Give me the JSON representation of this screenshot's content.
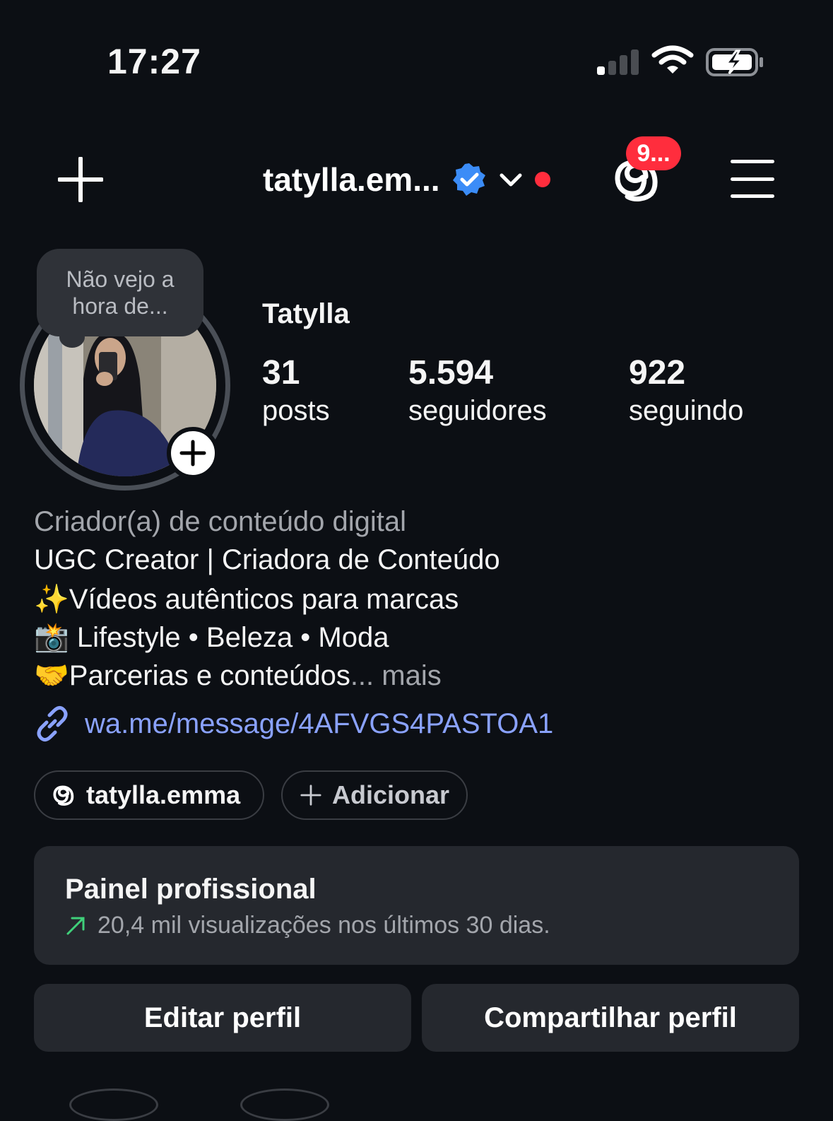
{
  "status_bar": {
    "time": "17:27"
  },
  "header": {
    "username": "tatylla.em...",
    "notification_count": "9..."
  },
  "note": {
    "text": "Não vejo a hora de..."
  },
  "profile": {
    "display_name": "Tatylla",
    "stats": [
      {
        "value": "31",
        "label": "posts"
      },
      {
        "value": "5.594",
        "label": "seguidores"
      },
      {
        "value": "922",
        "label": "seguindo"
      }
    ]
  },
  "bio": {
    "category": "Criador(a) de conteúdo digital",
    "lines": [
      "UGC Creator | Criadora de Conteúdo",
      "✨Vídeos autênticos para marcas",
      "📸 Lifestyle • Beleza • Moda",
      "🤝Parcerias e conteúdos"
    ],
    "ellipsis": "...",
    "more_label": "mais",
    "link": "wa.me/message/4AFVGS4PASTOA1"
  },
  "chips": {
    "threads_handle": "tatylla.emma",
    "add_label": "Adicionar"
  },
  "professional_panel": {
    "title": "Painel profissional",
    "subtitle": "20,4 mil visualizações nos últimos 30 dias."
  },
  "actions": {
    "edit_profile": "Editar perfil",
    "share_profile": "Compartilhar perfil"
  },
  "colors": {
    "background": "#0c0f14",
    "accent_link": "#8aa2ff",
    "verified_blue": "#3b8cf7",
    "badge_red": "#ff2d3d",
    "trend_green": "#3fd07a"
  },
  "icons": [
    "plus-icon",
    "verified-badge-icon",
    "chevron-down-icon",
    "threads-icon",
    "menu-icon",
    "link-icon",
    "trend-up-icon",
    "wifi-icon",
    "battery-charging-icon",
    "signal-icon"
  ]
}
